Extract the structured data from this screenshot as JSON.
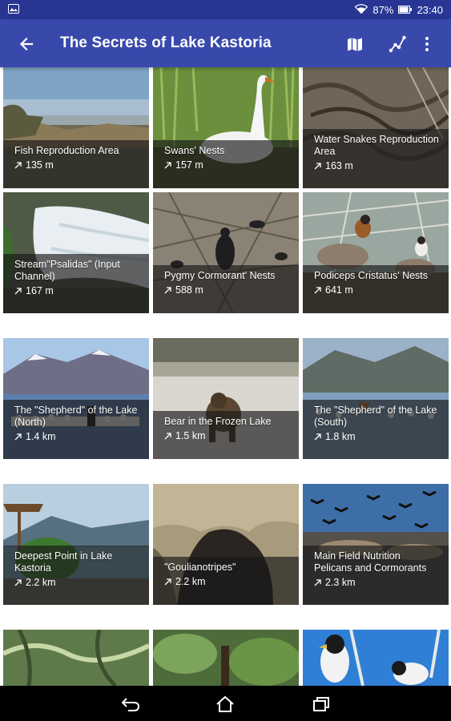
{
  "status_bar": {
    "battery": "87%",
    "time": "23:40"
  },
  "app_bar": {
    "title": "The Secrets of Lake Kastoria",
    "bg_color": "#3949ab"
  },
  "places": [
    {
      "name": "Fish Reproduction Area",
      "distance": "135 m"
    },
    {
      "name": "Swans' Nests",
      "distance": "157 m"
    },
    {
      "name": "Water Snakes Reproduction Area",
      "distance": "163 m"
    },
    {
      "name": "Stream\"Psalidas\" (Input Channel)",
      "distance": "167 m"
    },
    {
      "name": "Pygmy Cormorant' Nests",
      "distance": "588 m"
    },
    {
      "name": "Podiceps Cristatus' Nests",
      "distance": "641 m"
    },
    {
      "name": "The \"Shepherd\" of the Lake (North)",
      "distance": "1.4 km"
    },
    {
      "name": "Bear in the Frozen Lake",
      "distance": "1.5 km"
    },
    {
      "name": "The \"Shepherd\" of the Lake (South)",
      "distance": "1.8 km"
    },
    {
      "name": "Deepest Point in Lake Kastoria",
      "distance": "2.2 km"
    },
    {
      "name": "\"Goulianotripes\"",
      "distance": "2.2 km"
    },
    {
      "name": "Main Field Nutrition Pelicans and Cormorants",
      "distance": "2.3 km"
    },
    {
      "name": "",
      "distance": ""
    },
    {
      "name": "",
      "distance": ""
    },
    {
      "name": "",
      "distance": ""
    }
  ],
  "icons": {
    "back": "arrow-back-icon",
    "map": "map-icon",
    "route": "route-icon",
    "more": "more-vert-icon",
    "distance": "north-east-arrow-icon",
    "nav_back": "nav-back-icon",
    "nav_home": "nav-home-icon",
    "nav_recents": "nav-recents-icon"
  }
}
